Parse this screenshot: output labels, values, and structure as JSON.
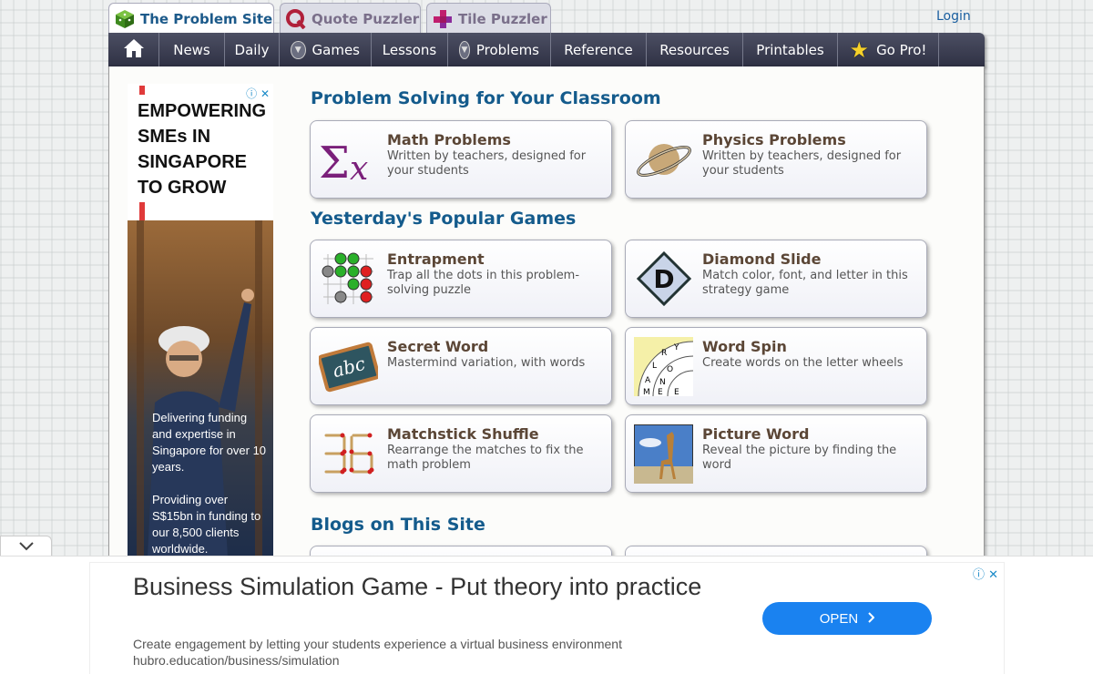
{
  "tabs": [
    {
      "label": "The Problem Site",
      "icon": "cube-icon"
    },
    {
      "label": "Quote Puzzler",
      "icon": "q-logo-icon"
    },
    {
      "label": "Tile Puzzler",
      "icon": "tiles-icon"
    }
  ],
  "login_label": "Login",
  "nav": {
    "home_icon": "home-icon",
    "items": [
      "News",
      "Daily",
      "Games",
      "Lessons",
      "Problems",
      "Reference",
      "Resources",
      "Printables",
      "Go Pro!"
    ]
  },
  "side_ad": {
    "headline": "EMPOWERING SMEs IN SINGAPORE TO GROW",
    "body1": "Delivering funding and expertise in Singapore for over 10 years.",
    "body2": "Providing over S$15bn in funding to our 8,500 clients worldwide."
  },
  "sections": {
    "classroom": "Problem Solving for Your Classroom",
    "games": "Yesterday's Popular Games",
    "blogs": "Blogs on This Site"
  },
  "classroom_cards": [
    {
      "title": "Math Problems",
      "desc": "Written by teachers, designed for your students",
      "icon": "sigma-x-icon"
    },
    {
      "title": "Physics Problems",
      "desc": "Written by teachers, designed for your students",
      "icon": "saturn-icon"
    }
  ],
  "game_cards": [
    {
      "title": "Entrapment",
      "desc": "Trap all the dots in this problem-solving puzzle",
      "icon": "dots-grid-icon"
    },
    {
      "title": "Diamond Slide",
      "desc": "Match color, font, and letter in this strategy game",
      "icon": "diamond-d-icon"
    },
    {
      "title": "Secret Word",
      "desc": "Mastermind variation, with words",
      "icon": "chalkboard-abc-icon"
    },
    {
      "title": "Word Spin",
      "desc": "Create words on the letter wheels",
      "icon": "letter-wheel-icon"
    },
    {
      "title": "Matchstick Shuffle",
      "desc": "Rearrange the matches to fix the math problem",
      "icon": "matchstick-36-icon"
    },
    {
      "title": "Picture Word",
      "desc": "Reveal the picture by finding the word",
      "icon": "giraffe-picture-icon"
    }
  ],
  "bottom_ad": {
    "title": "Business Simulation Game - Put theory into practice",
    "subtitle": "Create engagement by letting your students experience a virtual business environment",
    "url": "hubro.education/business/simulation",
    "button": "OPEN"
  }
}
